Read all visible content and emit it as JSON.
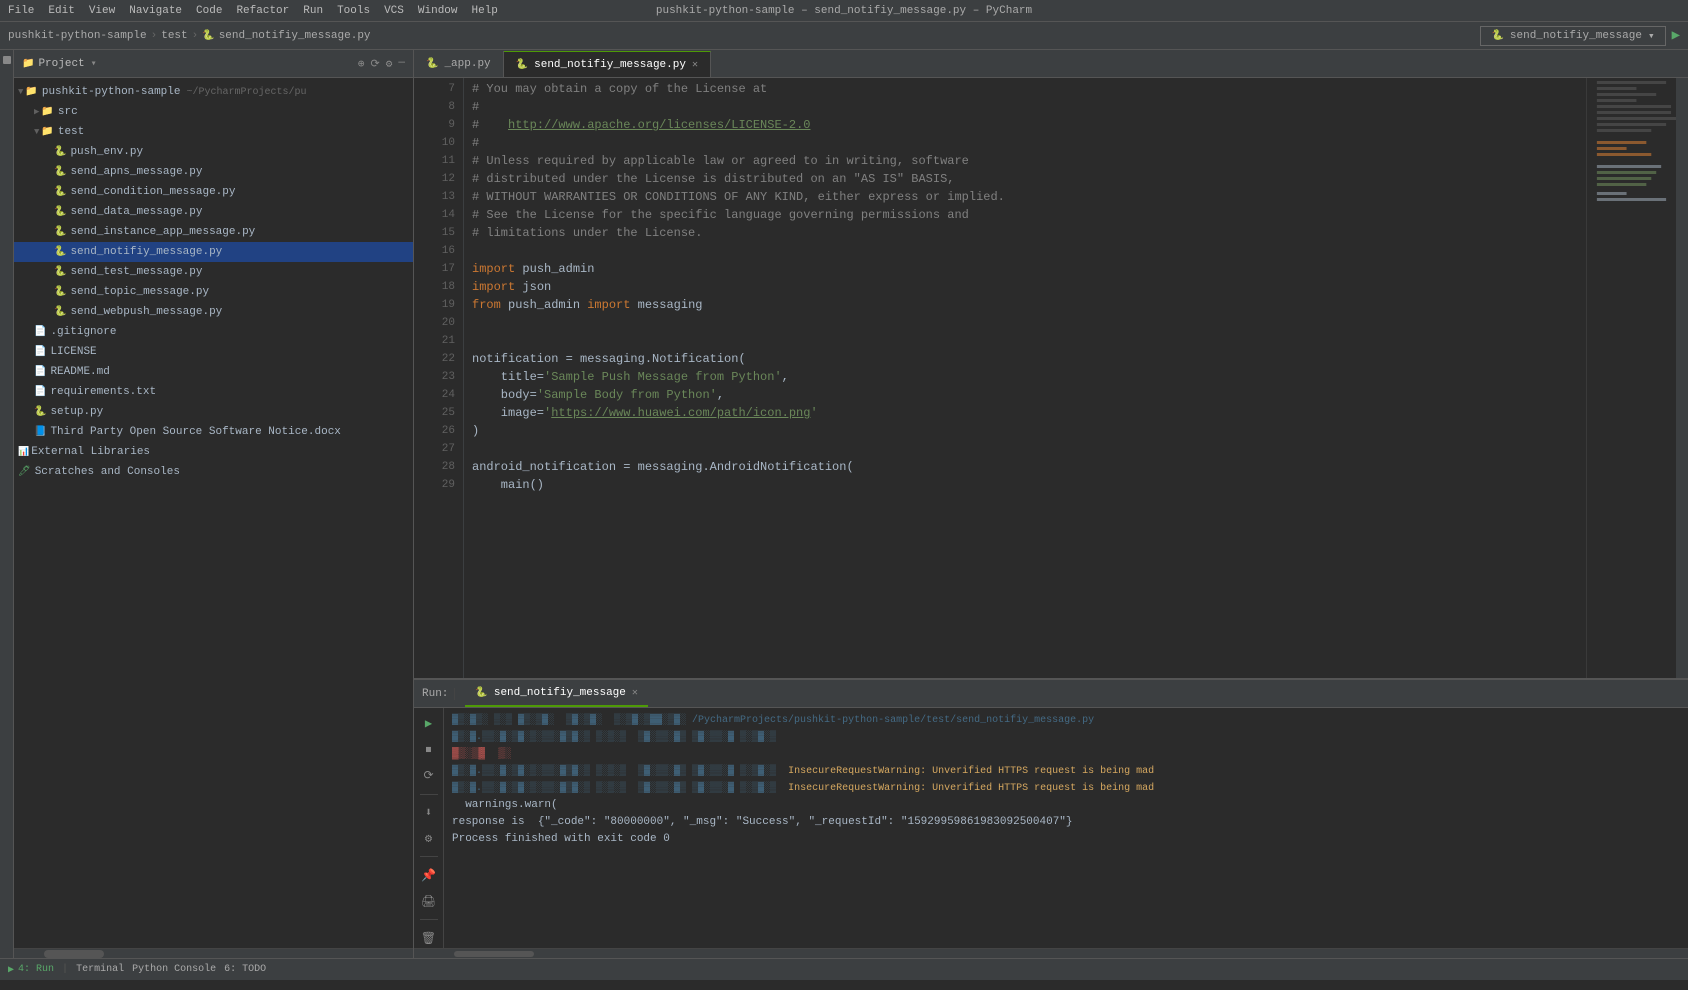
{
  "window": {
    "title": "pushkit-python-sample – send_notifiy_message.py – PyCharm"
  },
  "menu": {
    "items": [
      "File",
      "Edit",
      "View",
      "Navigate",
      "Code",
      "Refactor",
      "Run",
      "Tools",
      "VCS",
      "Window",
      "Help"
    ]
  },
  "breadcrumb": {
    "items": [
      "pushkit-python-sample",
      "test",
      "send_notifiy_message.py"
    ]
  },
  "project_panel": {
    "title": "Project",
    "icons": [
      "⊕",
      "⟳",
      "⚙",
      "—"
    ]
  },
  "file_tree": {
    "root": "pushkit-python-sample",
    "root_path": "~/PycharmProjects/pu",
    "items": [
      {
        "label": "src",
        "type": "folder",
        "indent": 1,
        "expanded": false
      },
      {
        "label": "test",
        "type": "folder",
        "indent": 1,
        "expanded": true
      },
      {
        "label": "push_env.py",
        "type": "py",
        "indent": 2
      },
      {
        "label": "send_apns_message.py",
        "type": "py",
        "indent": 2
      },
      {
        "label": "send_condition_message.py",
        "type": "py",
        "indent": 2
      },
      {
        "label": "send_data_message.py",
        "type": "py",
        "indent": 2
      },
      {
        "label": "send_instance_app_message.py",
        "type": "py",
        "indent": 2
      },
      {
        "label": "send_notifiy_message.py",
        "type": "py",
        "indent": 2,
        "selected": true
      },
      {
        "label": "send_test_message.py",
        "type": "py",
        "indent": 2
      },
      {
        "label": "send_topic_message.py",
        "type": "py",
        "indent": 2
      },
      {
        "label": "send_webpush_message.py",
        "type": "py",
        "indent": 2
      },
      {
        "label": ".gitignore",
        "type": "git",
        "indent": 1
      },
      {
        "label": "LICENSE",
        "type": "text",
        "indent": 1
      },
      {
        "label": "README.md",
        "type": "text",
        "indent": 1
      },
      {
        "label": "requirements.txt",
        "type": "text",
        "indent": 1
      },
      {
        "label": "setup.py",
        "type": "py",
        "indent": 1
      },
      {
        "label": "Third Party Open Source Software Notice.docx",
        "type": "doc",
        "indent": 1
      },
      {
        "label": "External Libraries",
        "type": "lib",
        "indent": 0
      },
      {
        "label": "Scratches and Consoles",
        "type": "scratch",
        "indent": 0
      }
    ]
  },
  "tabs": {
    "items": [
      {
        "label": "_app.py",
        "active": false
      },
      {
        "label": "send_notifiy_message.py",
        "active": true
      }
    ]
  },
  "code": {
    "lines": [
      {
        "num": 7,
        "content": "# You may obtain a copy of the License at"
      },
      {
        "num": 8,
        "content": "#"
      },
      {
        "num": 9,
        "content": "#    http://www.apache.org/licenses/LICENSE-2.0"
      },
      {
        "num": 10,
        "content": "#"
      },
      {
        "num": 11,
        "content": "# Unless required by applicable law or agreed to in writing, software"
      },
      {
        "num": 12,
        "content": "# distributed under the License is distributed on an \"AS IS\" BASIS,"
      },
      {
        "num": 13,
        "content": "# WITHOUT WARRANTIES OR CONDITIONS OF ANY KIND, either express or implied."
      },
      {
        "num": 14,
        "content": "# See the License for the specific language governing permissions and"
      },
      {
        "num": 15,
        "content": "# limitations under the License."
      },
      {
        "num": 16,
        "content": ""
      },
      {
        "num": 17,
        "content": "import push_admin"
      },
      {
        "num": 18,
        "content": "import json"
      },
      {
        "num": 19,
        "content": "from push_admin import messaging"
      },
      {
        "num": 20,
        "content": ""
      },
      {
        "num": 21,
        "content": ""
      },
      {
        "num": 22,
        "content": "notification = messaging.Notification("
      },
      {
        "num": 23,
        "content": "    title='Sample Push Message from Python',"
      },
      {
        "num": 24,
        "content": "    body='Sample Body from Python',"
      },
      {
        "num": 25,
        "content": "    image='https://www.huawei.com/path/icon.png'"
      },
      {
        "num": 26,
        "content": ")"
      },
      {
        "num": 27,
        "content": ""
      },
      {
        "num": 28,
        "content": "android_notification = messaging.AndroidNotification("
      },
      {
        "num": 29,
        "content": "    main()"
      }
    ]
  },
  "run_panel": {
    "tab_label": "send_notifiy_message",
    "output_lines": [
      {
        "text": "/PycharmProjects/pushkit-python-sample/test/send_notifiy_message.py",
        "type": "path"
      },
      {
        "text": "InsecureRequestWarning: Unverified HTTPS request is being mad",
        "type": "warn"
      },
      {
        "text": "InsecureRequestWarning: Unverified HTTPS request is being mad",
        "type": "warn"
      },
      {
        "text": "  warnings.warn(",
        "type": "normal"
      },
      {
        "text": "response is  {\"_code\": \"80000000\", \"_msg\": \"Success\", \"_requestId\": \"15929959861983092500407\"}",
        "type": "normal"
      },
      {
        "text": "",
        "type": "normal"
      },
      {
        "text": "Process finished with exit code 0",
        "type": "normal"
      }
    ]
  },
  "status_bar": {
    "run_label": "Run:",
    "tab_label": "send_notifiy_message",
    "tabs": [
      "Terminal",
      "Python Console",
      "6: TODO"
    ],
    "play_speed": "4: Run"
  },
  "run_config_dropdown": "send_notifiy_message"
}
